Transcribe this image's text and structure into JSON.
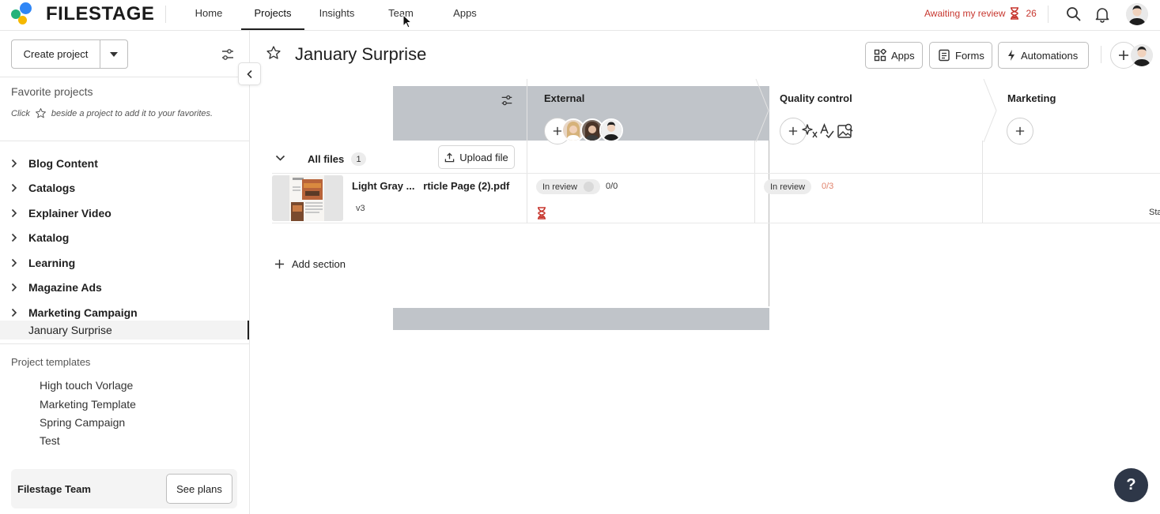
{
  "app": {
    "logo_text": "FILESTAGE"
  },
  "nav": {
    "tabs": [
      {
        "label": "Home"
      },
      {
        "label": "Projects"
      },
      {
        "label": "Insights"
      },
      {
        "label": "Team"
      },
      {
        "label": "Apps"
      }
    ],
    "active_tab": "Projects",
    "awaiting_label": "Awaiting my review",
    "awaiting_count": "26"
  },
  "sidebar": {
    "create_project_label": "Create project",
    "favorites_title": "Favorite projects",
    "favorites_hint_prefix": "Click",
    "favorites_hint_suffix": "beside a project to add it to your favorites.",
    "projects": [
      {
        "label": "Blog Content"
      },
      {
        "label": "Catalogs"
      },
      {
        "label": "Explainer Video"
      },
      {
        "label": "Katalog"
      },
      {
        "label": "Learning"
      },
      {
        "label": "Magazine Ads"
      },
      {
        "label": "Marketing Campaign"
      }
    ],
    "selected_project": "January Surprise",
    "templates_title": "Project templates",
    "templates": [
      {
        "label": "High touch Vorlage"
      },
      {
        "label": "Marketing Template"
      },
      {
        "label": "Spring Campaign"
      },
      {
        "label": "Test"
      }
    ],
    "team_name": "Filestage Team",
    "see_plans_label": "See plans"
  },
  "header": {
    "title": "January Surprise",
    "apps_label": "Apps",
    "forms_label": "Forms",
    "automations_label": "Automations"
  },
  "stages": [
    {
      "name": "External"
    },
    {
      "name": "Quality control"
    },
    {
      "name": "Marketing"
    }
  ],
  "files_section": {
    "label": "All files",
    "count": "1",
    "upload_label": "Upload file",
    "add_section_label": "Add section"
  },
  "file": {
    "name": "Light Gray ...   rticle Page (2).pdf",
    "version": "v3",
    "external_status": "In review",
    "external_count": "0/0",
    "qc_status": "In review",
    "qc_count": "0/3",
    "truncated_text": "Sta"
  },
  "help": {
    "label": "?"
  },
  "colors": {
    "accent_red": "#c7372f",
    "overlay_gray": "#c0c4c9",
    "help_bg": "#2e3748",
    "qc_count_color": "#e0826b"
  }
}
